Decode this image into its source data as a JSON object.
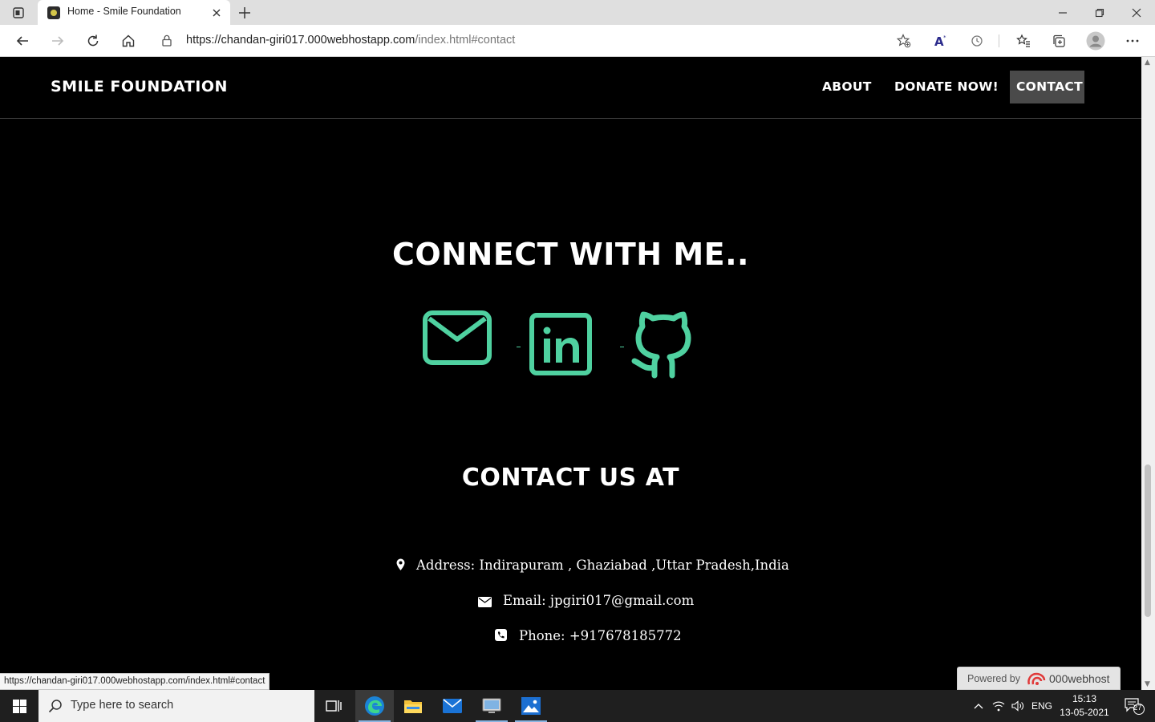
{
  "browser": {
    "tab_title": "Home - Smile Foundation",
    "url_main": "https://chandan-giri017.000webhostapp.com",
    "url_path": "/index.html#contact",
    "status_url": "https://chandan-giri017.000webhostapp.com/index.html#contact"
  },
  "site": {
    "brand": "SMILE FOUNDATION",
    "nav": [
      {
        "label": "ABOUT"
      },
      {
        "label": "DONATE NOW!"
      },
      {
        "label": "CONTACT"
      }
    ],
    "connect_heading": "CONNECT WITH ME..",
    "social_icons": [
      "mail-icon",
      "linkedin-icon",
      "github-icon"
    ],
    "accent_color": "#4fd1a0",
    "contact_heading": "CONTACT US AT",
    "address": "Address: Indirapuram , Ghaziabad ,Uttar Pradesh,India",
    "email": "Email: jpgiri017@gmail.com",
    "phone": "Phone: +917678185772"
  },
  "host_badge": {
    "label": "Powered by",
    "brand": "000webhost"
  },
  "taskbar": {
    "search_placeholder": "Type here to search",
    "lang": "ENG",
    "time": "15:13",
    "date": "13-05-2021",
    "notification_count": "27"
  }
}
